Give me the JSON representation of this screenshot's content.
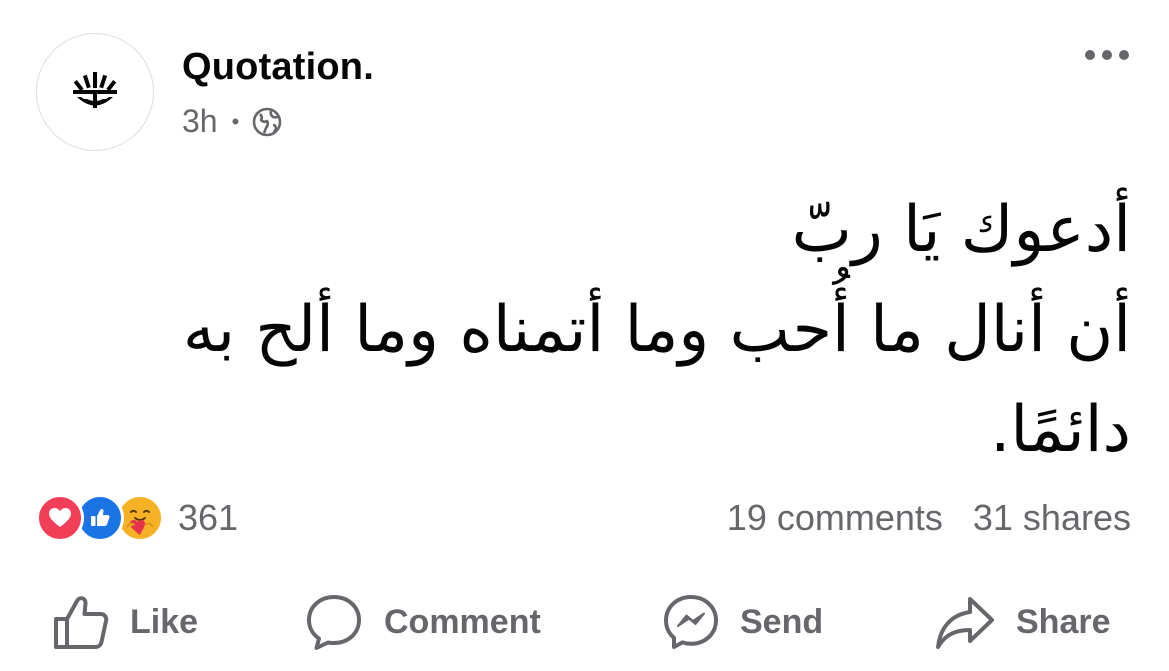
{
  "post": {
    "page_name": "Quotation.",
    "time": "3h",
    "audience_icon": "globe-icon",
    "more_icon": "more-options-icon",
    "text_lines": [
      "أدعوك يَا ربّ",
      "أن أنال ما أُحب وما أتمناه وما ألح به",
      "دائمًا."
    ]
  },
  "reactions": {
    "icons": [
      "love-reaction-icon",
      "like-reaction-icon",
      "care-reaction-icon"
    ],
    "count": "361"
  },
  "stats": {
    "comments": "19 comments",
    "shares": "31 shares"
  },
  "actions": {
    "like": "Like",
    "comment": "Comment",
    "send": "Send",
    "share": "Share"
  },
  "colors": {
    "text_primary": "#050505",
    "text_secondary": "#65676b",
    "love": "#f33e58",
    "like": "#1b74e4",
    "care": "#f7b125"
  }
}
